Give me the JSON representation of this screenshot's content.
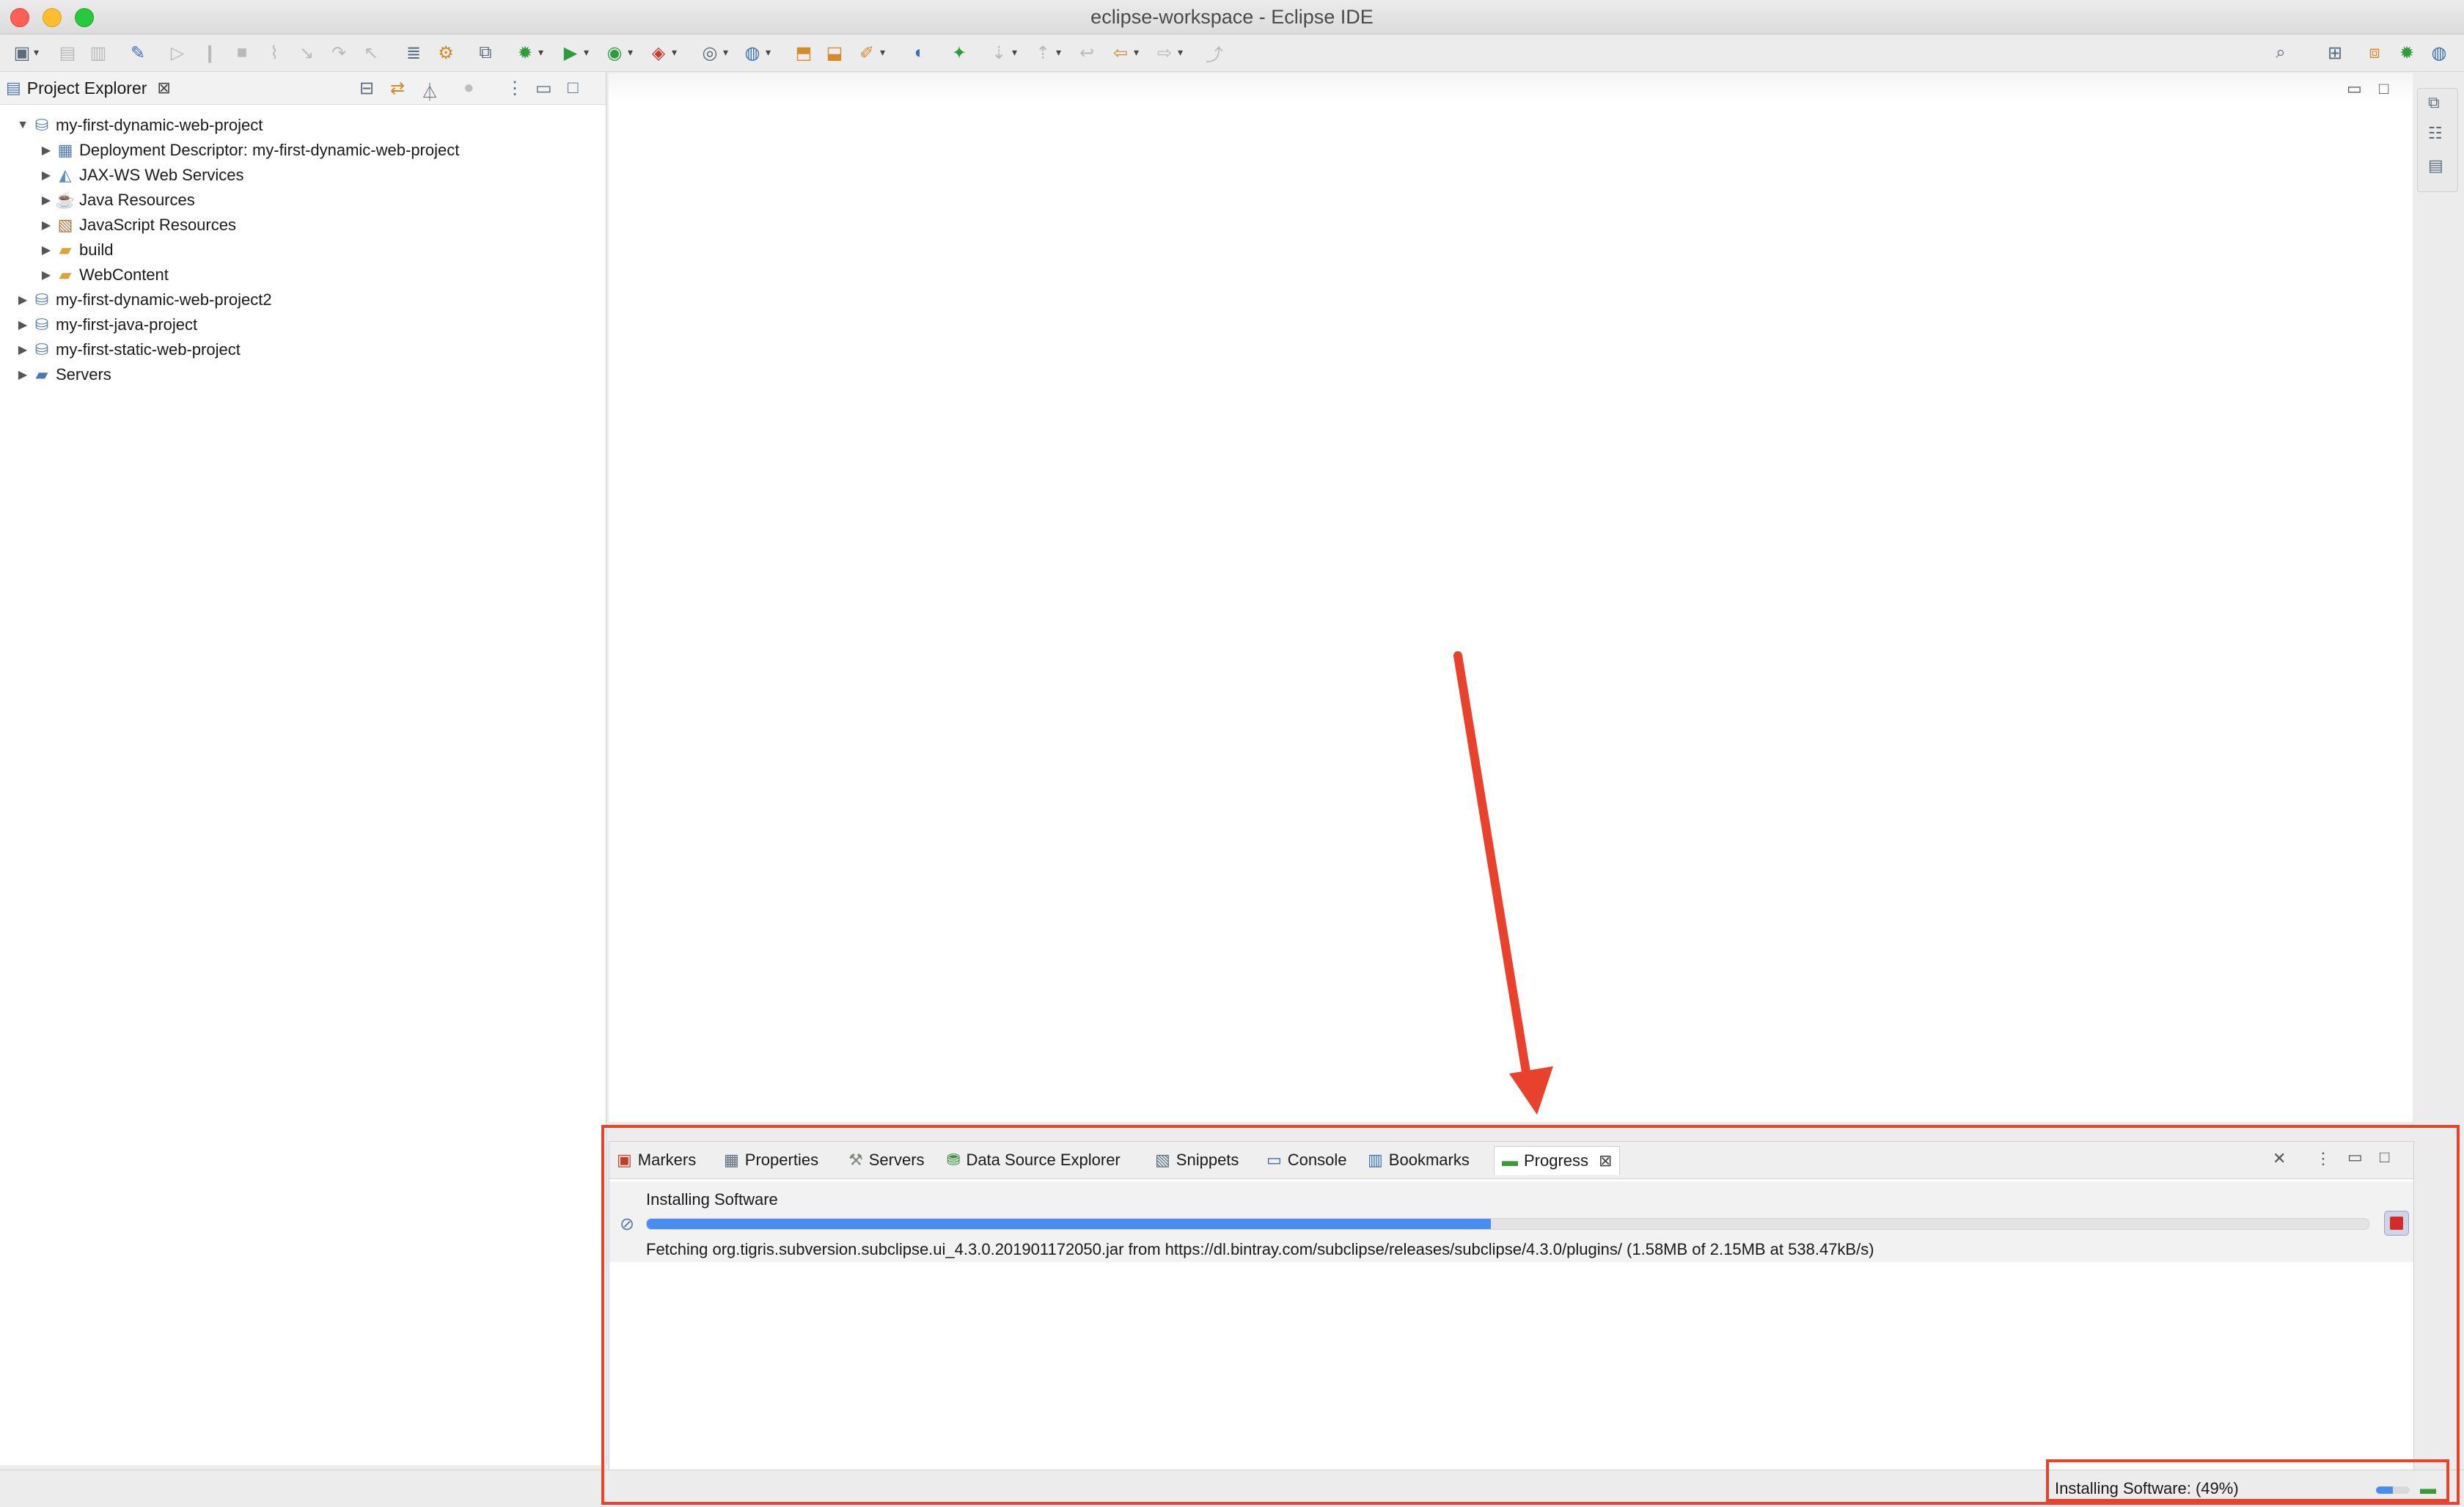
{
  "window": {
    "title": "eclipse-workspace - Eclipse IDE"
  },
  "explorer": {
    "tab_label": "Project Explorer",
    "items": [
      {
        "label": "my-first-dynamic-web-project",
        "level": 0,
        "expanded": true,
        "icon": "web-project-icon"
      },
      {
        "label": "Deployment Descriptor: my-first-dynamic-web-project",
        "level": 1,
        "icon": "deployment-descriptor-icon"
      },
      {
        "label": "JAX-WS Web Services",
        "level": 1,
        "icon": "web-services-icon"
      },
      {
        "label": "Java Resources",
        "level": 1,
        "icon": "java-resources-icon"
      },
      {
        "label": "JavaScript Resources",
        "level": 1,
        "icon": "javascript-resources-icon"
      },
      {
        "label": "build",
        "level": 1,
        "icon": "folder-icon"
      },
      {
        "label": "WebContent",
        "level": 1,
        "icon": "folder-icon"
      },
      {
        "label": "my-first-dynamic-web-project2",
        "level": 0,
        "icon": "web-project-icon"
      },
      {
        "label": "my-first-java-project",
        "level": 0,
        "icon": "java-project-icon"
      },
      {
        "label": "my-first-static-web-project",
        "level": 0,
        "icon": "web-project-icon"
      },
      {
        "label": "Servers",
        "level": 0,
        "icon": "folder-icon"
      }
    ]
  },
  "bottom_panel": {
    "tabs": [
      {
        "label": "Markers",
        "icon": "markers-icon"
      },
      {
        "label": "Properties",
        "icon": "properties-icon"
      },
      {
        "label": "Servers",
        "icon": "servers-icon"
      },
      {
        "label": "Data Source Explorer",
        "icon": "data-source-icon"
      },
      {
        "label": "Snippets",
        "icon": "snippets-icon"
      },
      {
        "label": "Console",
        "icon": "console-icon"
      },
      {
        "label": "Bookmarks",
        "icon": "bookmarks-icon"
      },
      {
        "label": "Progress",
        "icon": "progress-icon",
        "active": true
      }
    ],
    "progress": {
      "title": "Installing Software",
      "fraction": 0.49,
      "detail": "Fetching org.tigris.subversion.subclipse.ui_4.3.0.201901172050.jar from https://dl.bintray.com/subclipse/releases/subclipse/4.3.0/plugins/ (1.58MB of 2.15MB at 538.47kB/s)"
    }
  },
  "status_bar": {
    "text": "Installing Software: (49%)",
    "progress_fraction": 0.49
  },
  "annotation_color": "#e8412c",
  "accent_color": "#4a8cf0"
}
